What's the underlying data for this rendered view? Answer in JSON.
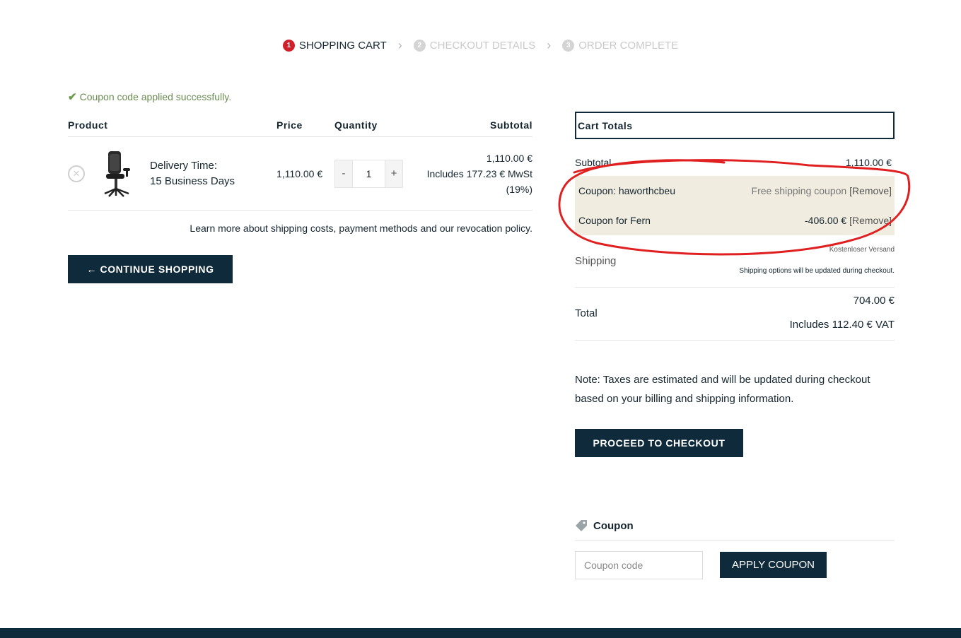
{
  "steps": [
    {
      "num": "1",
      "label": "SHOPPING CART"
    },
    {
      "num": "2",
      "label": "CHECKOUT DETAILS"
    },
    {
      "num": "3",
      "label": "ORDER COMPLETE"
    }
  ],
  "notice": {
    "icon": "check-icon",
    "text": "Coupon code applied successfully."
  },
  "cart": {
    "headers": {
      "product": "Product",
      "price": "Price",
      "quantity": "Quantity",
      "subtotal": "Subtotal"
    },
    "item": {
      "remove_icon": "close-icon",
      "delivery_line1": "Delivery Time:",
      "delivery_line2": "15 Business Days",
      "price": "1,110.00 €",
      "qty_minus": "-",
      "qty_value": "1",
      "qty_plus": "+",
      "subtotal_amount": "1,110.00 €",
      "subtotal_tax": "Includes 177.23 €  MwSt",
      "subtotal_rate": "(19%)"
    },
    "learn_more": "Learn more about shipping costs, payment methods and our revocation policy.",
    "continue_label": "← CONTINUE SHOPPING"
  },
  "totals": {
    "title": "Cart Totals",
    "subtotal_label": "Subtotal",
    "subtotal_value": "1,110.00 €",
    "coupon1_label": "Coupon: haworthcbeu",
    "coupon1_value": "Free shipping coupon",
    "coupon1_remove": "[Remove]",
    "coupon2_label": "Coupon for Fern",
    "coupon2_value": "-406.00 €",
    "coupon2_remove": "[Remove]",
    "shipping_label": "Shipping",
    "shipping_method": "Kostenloser Versand",
    "shipping_note": "Shipping options will be updated during checkout.",
    "total_label": "Total",
    "total_value": "704.00 €",
    "total_vat": "Includes 112.40 €  VAT"
  },
  "tax_note": "Note: Taxes are estimated and will be updated during checkout based on your billing and shipping information.",
  "checkout_label": "PROCEED TO CHECKOUT",
  "coupon": {
    "title": "Coupon",
    "icon": "tag-icon",
    "placeholder": "Coupon code",
    "apply_label": "APPLY COUPON"
  },
  "colors": {
    "brand_dark": "#0f2a3a",
    "step_active": "#d0202b",
    "coupon_bg": "#f1ece0",
    "annotation": "#e02020"
  }
}
